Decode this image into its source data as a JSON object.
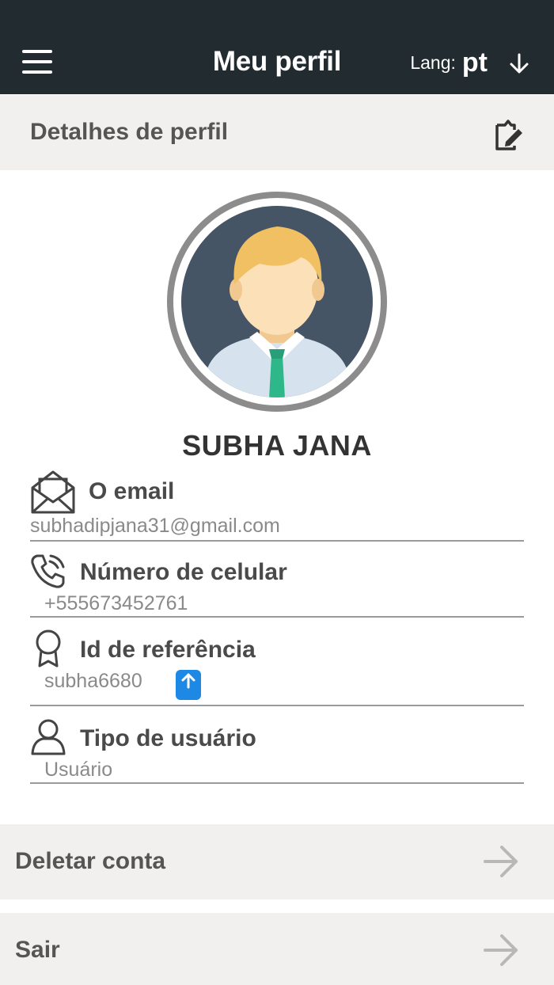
{
  "header": {
    "title": "Meu perfil",
    "lang_label": "Lang:",
    "lang_value": "pt"
  },
  "profile": {
    "section_title": "Detalhes de perfil",
    "name": "SUBHA JANA",
    "fields": [
      {
        "label": "O email",
        "value": "subhadipjana31@gmail.com",
        "icon": "envelope-icon"
      },
      {
        "label": "Número de celular",
        "value": "+555673452761",
        "icon": "phone-icon"
      },
      {
        "label": "Id de referência",
        "value": "subha6680",
        "icon": "award-icon"
      },
      {
        "label": "Tipo de usuário",
        "value": "Usuário",
        "icon": "user-icon"
      }
    ]
  },
  "actions": {
    "delete_label": "Deletar conta",
    "logout_label": "Sair"
  },
  "colors": {
    "topbar": "#222b30",
    "section_bg": "#f2f0ef",
    "share_button": "#1e88e5",
    "avatar_bg": "#465566"
  }
}
